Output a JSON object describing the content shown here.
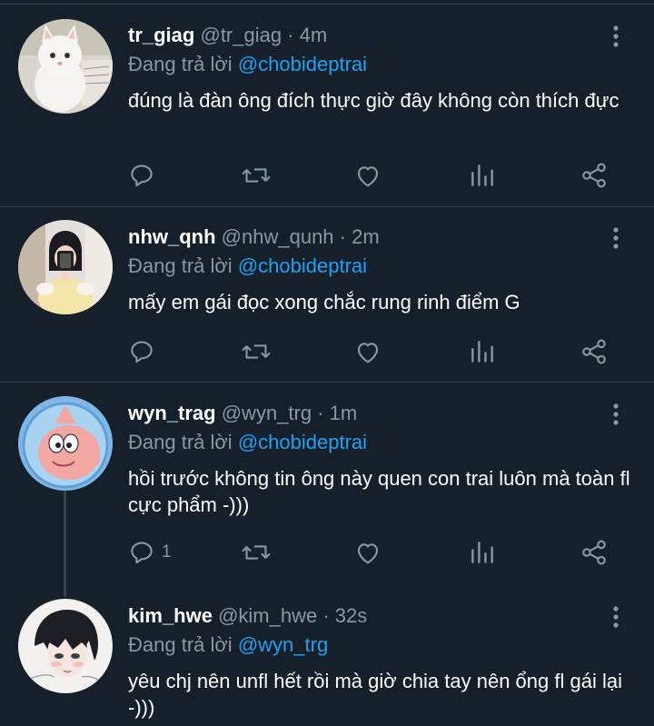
{
  "tweets": [
    {
      "name": "tr_giag",
      "handle": "@tr_giag",
      "sep": "·",
      "time": "4m",
      "reply_prefix": "Đang trả lời",
      "reply_to": "@chobideptrai",
      "text": "đúng là đàn ông đích thực giờ đây không còn thích đực",
      "reply_count": "",
      "avatar": "white-kitten-avatar"
    },
    {
      "name": "nhw_qnh",
      "handle": "@nhw_qunh",
      "sep": "·",
      "time": "2m",
      "reply_prefix": "Đang trả lời",
      "reply_to": "@chobideptrai",
      "text": "mấy em gái đọc xong chắc rung rinh điểm G",
      "reply_count": "",
      "avatar": "girl-mirror-selfie-avatar"
    },
    {
      "name": "wyn_trag",
      "handle": "@wyn_trg",
      "sep": "·",
      "time": "1m",
      "reply_prefix": "Đang trả lời",
      "reply_to": "@chobideptrai",
      "text": "hồi trước không tin ông này quen con trai luôn mà toàn fl cực phẩm -)))",
      "reply_count": "1",
      "avatar": "patrick-star-avatar"
    },
    {
      "name": "kim_hwe",
      "handle": "@kim_hwe",
      "sep": "·",
      "time": "32s",
      "reply_prefix": "Đang trả lời",
      "reply_to": "@wyn_trg",
      "text": "yêu chj nên unfl hết rồi mà giờ chia tay nên ổng fl gái lại -)))",
      "reply_count": "",
      "avatar": "anime-boy-avatar"
    }
  ],
  "icons": {
    "reply": "reply-icon",
    "retweet": "retweet-icon",
    "like": "like-icon",
    "analytics": "analytics-icon",
    "share": "share-icon",
    "more": "more-vertical-icon"
  },
  "colors": {
    "background": "#15202b",
    "divider": "#38444d",
    "secondary_text": "#8899a6",
    "mention": "#1da1f2",
    "primary_text": "#ffffff"
  }
}
